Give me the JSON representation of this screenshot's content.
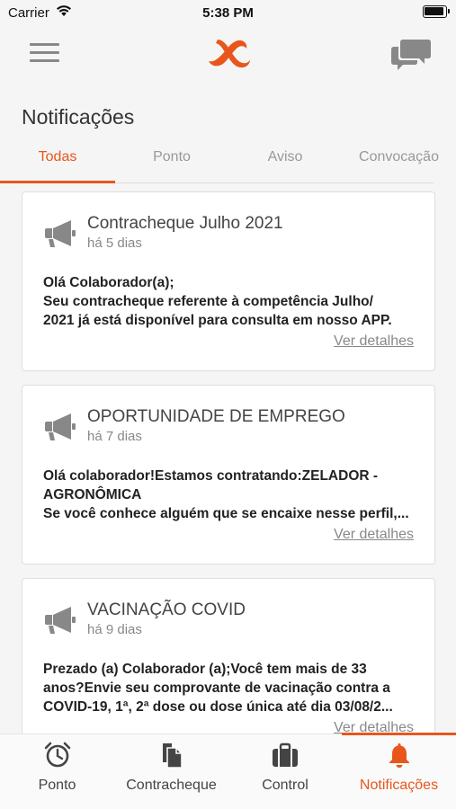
{
  "status_bar": {
    "carrier": "Carrier",
    "time": "5:38 PM"
  },
  "header": {
    "title": "Notificações"
  },
  "tabs": [
    {
      "label": "Todas",
      "active": true
    },
    {
      "label": "Ponto",
      "active": false
    },
    {
      "label": "Aviso",
      "active": false
    },
    {
      "label": "Convocação",
      "active": false
    }
  ],
  "notifications": [
    {
      "title": "Contracheque Julho 2021",
      "time": "há 5 dias",
      "body_lines": [
        "Olá Colaborador(a);",
        "Seu contracheque referente à competência Julho/",
        "2021 já está disponível para consulta em nosso APP."
      ],
      "link": "Ver detalhes"
    },
    {
      "title": "OPORTUNIDADE DE EMPREGO",
      "time": "há 7 dias",
      "body_lines": [
        "Olá colaborador!Estamos contratando:ZELADOR -",
        "AGRONÔMICA",
        "Se você conhece alguém que se encaixe nesse perfil,..."
      ],
      "link": "Ver detalhes"
    },
    {
      "title": "VACINAÇÃO COVID",
      "time": "há 9 dias",
      "body_lines": [
        "Prezado (a) Colaborador (a);Você tem mais de 33",
        "anos?Envie seu comprovante de vacinação contra a",
        "COVID-19, 1ª, 2ª dose ou dose única até dia 03/08/2..."
      ],
      "link": "Ver detalhes"
    }
  ],
  "bottom_nav": [
    {
      "label": "Ponto",
      "icon": "clock-icon",
      "active": false
    },
    {
      "label": "Contracheque",
      "icon": "documents-icon",
      "active": false
    },
    {
      "label": "Control",
      "icon": "briefcase-icon",
      "active": false
    },
    {
      "label": "Notificações",
      "icon": "bell-icon",
      "active": true
    }
  ],
  "colors": {
    "accent": "#e8561c",
    "icon_gray": "#888888",
    "background": "#f5f5f5"
  }
}
